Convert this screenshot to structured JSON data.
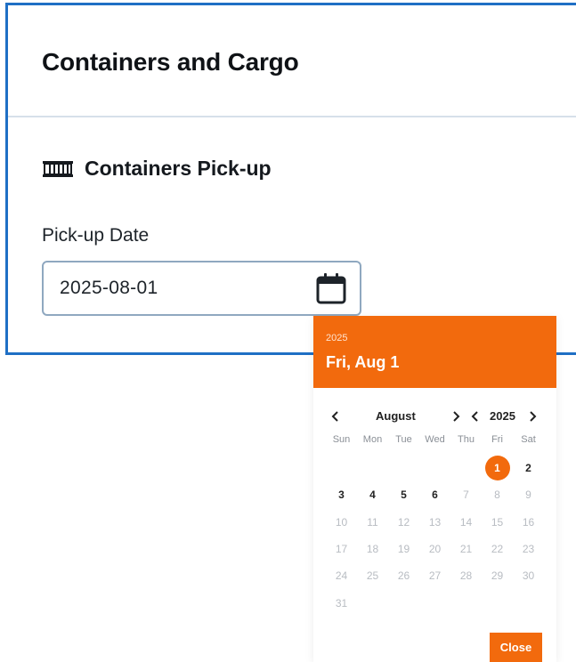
{
  "page": {
    "title": "Containers and Cargo"
  },
  "section": {
    "title": "Containers Pick-up",
    "icon": "shipping-container-icon"
  },
  "pickup_field": {
    "label": "Pick-up Date",
    "value": "2025-08-01",
    "icon": "calendar-icon"
  },
  "picker": {
    "header_year": "2025",
    "header_date": "Fri, Aug 1",
    "month": "August",
    "year": "2025",
    "weekdays": [
      "Sun",
      "Mon",
      "Tue",
      "Wed",
      "Thu",
      "Fri",
      "Sat"
    ],
    "days": [
      "1",
      "2",
      "3",
      "4",
      "5",
      "6",
      "7",
      "8",
      "9",
      "10",
      "11",
      "12",
      "13",
      "14",
      "15",
      "16",
      "17",
      "18",
      "19",
      "20",
      "21",
      "22",
      "23",
      "24",
      "25",
      "26",
      "27",
      "28",
      "29",
      "30",
      "31"
    ],
    "first_weekday_index": 5,
    "selected_day": "1",
    "enabled_days": [
      "1",
      "2",
      "3",
      "4",
      "5",
      "6"
    ],
    "close_label": "Close"
  },
  "colors": {
    "accent": "#f26a0d",
    "panel_border": "#1f6fc5"
  }
}
